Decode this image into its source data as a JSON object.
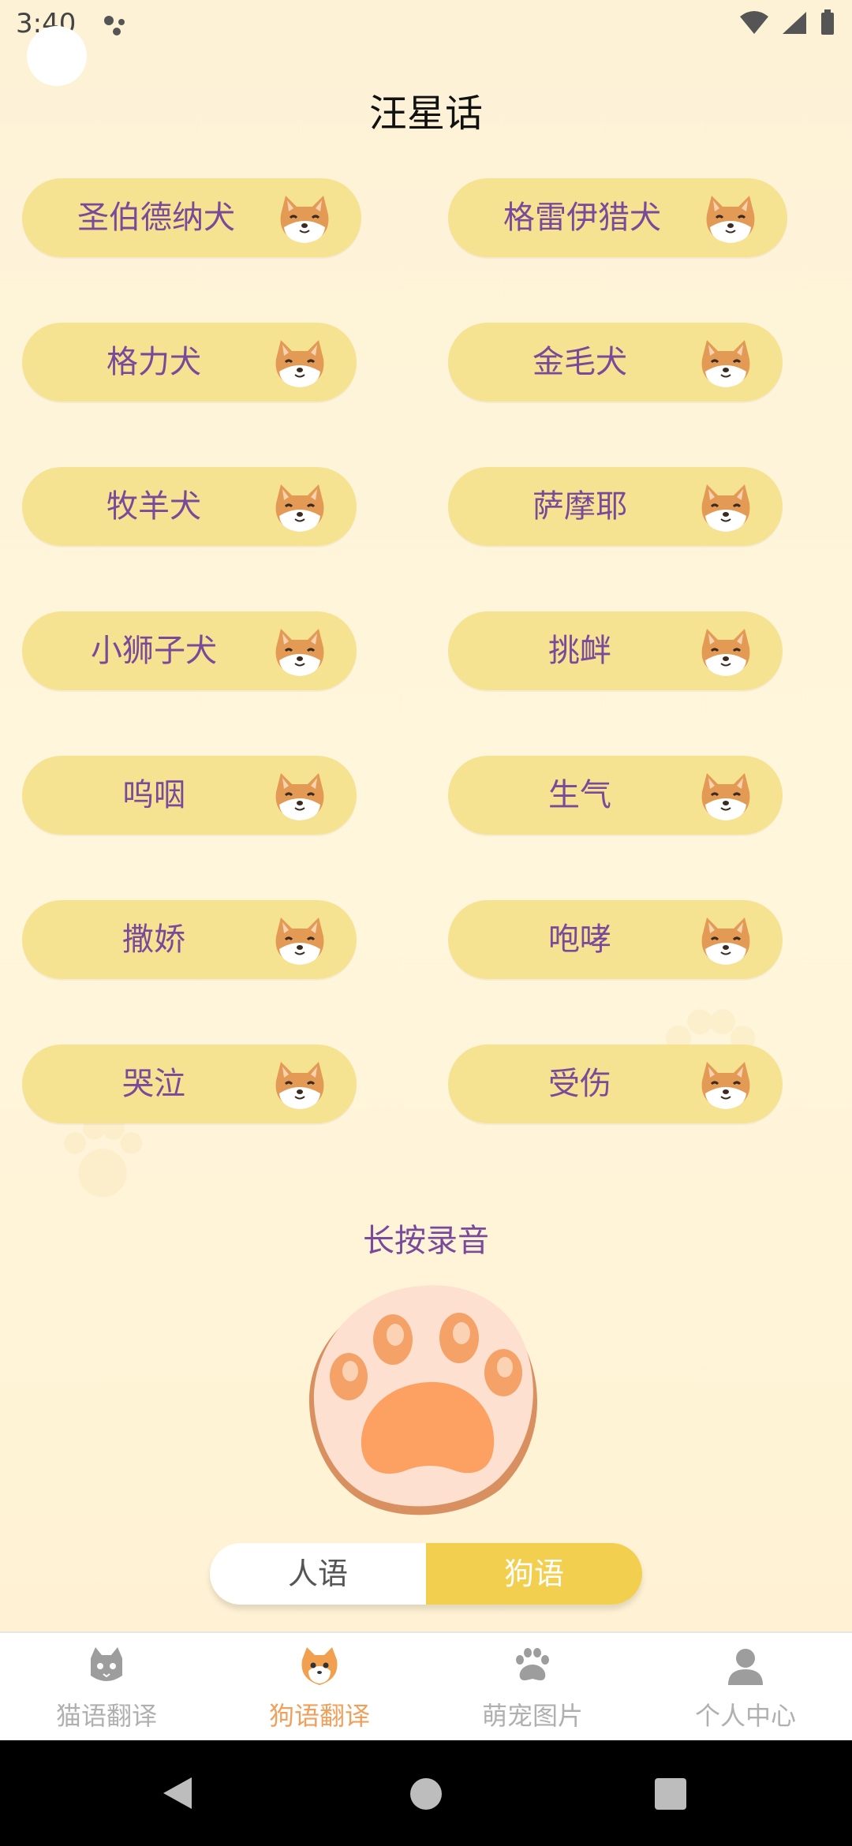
{
  "status": {
    "time": "3:40"
  },
  "header": {
    "title": "汪星话"
  },
  "sounds": [
    {
      "label": "圣伯德纳犬"
    },
    {
      "label": "格雷伊猎犬"
    },
    {
      "label": "格力犬"
    },
    {
      "label": "金毛犬"
    },
    {
      "label": "牧羊犬"
    },
    {
      "label": "萨摩耶"
    },
    {
      "label": "小狮子犬"
    },
    {
      "label": "挑衅"
    },
    {
      "label": "呜咽"
    },
    {
      "label": "生气"
    },
    {
      "label": "撒娇"
    },
    {
      "label": "咆哮"
    },
    {
      "label": "哭泣"
    },
    {
      "label": "受伤"
    }
  ],
  "record": {
    "label": "长按录音"
  },
  "toggle": {
    "human": "人语",
    "dog": "狗语",
    "selected": "狗语"
  },
  "tabs": [
    {
      "label": "猫语翻译",
      "icon": "cat-icon"
    },
    {
      "label": "狗语翻译",
      "icon": "dog-icon",
      "active": true
    },
    {
      "label": "萌宠图片",
      "icon": "paw-icon"
    },
    {
      "label": "个人中心",
      "icon": "person-icon"
    }
  ],
  "colors": {
    "pill": "#f6e392",
    "label": "#7a4a9a",
    "accent": "#f2cf4f",
    "activeTab": "#f0a05a"
  }
}
